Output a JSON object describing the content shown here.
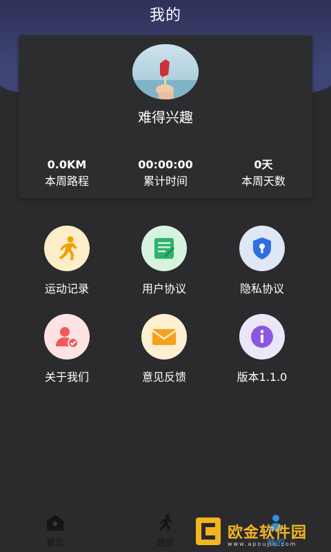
{
  "header": {
    "title": "我的"
  },
  "profile": {
    "username": "难得兴趣",
    "stats": [
      {
        "value": "0.0KM",
        "label": "本周路程"
      },
      {
        "value": "00:00:00",
        "label": "累计时间"
      },
      {
        "value": "0天",
        "label": "本周天数"
      }
    ]
  },
  "menu": [
    {
      "label": "运动记录",
      "icon": "running-icon",
      "bg": "#fbeec8"
    },
    {
      "label": "用户协议",
      "icon": "document-icon",
      "bg": "#d6f3df"
    },
    {
      "label": "隐私协议",
      "icon": "shield-icon",
      "bg": "#dfe6f6"
    },
    {
      "label": "关于我们",
      "icon": "user-check-icon",
      "bg": "#fde3e3"
    },
    {
      "label": "意见反馈",
      "icon": "envelope-icon",
      "bg": "#fdefcf"
    },
    {
      "label": "版本1.1.0",
      "icon": "info-icon",
      "bg": "#ebe6f8"
    }
  ],
  "tabbar": {
    "items": [
      {
        "label": "首页",
        "icon": "home-icon"
      },
      {
        "label": "跑步",
        "icon": "runner-icon"
      },
      {
        "label": "我的",
        "icon": "person-icon"
      }
    ]
  },
  "watermark": {
    "text": "欧金软件园",
    "url": "www.apoujin.com"
  },
  "colors": {
    "header": "#3f4778",
    "background": "#2b2b2d",
    "card": "#2d2d30"
  }
}
